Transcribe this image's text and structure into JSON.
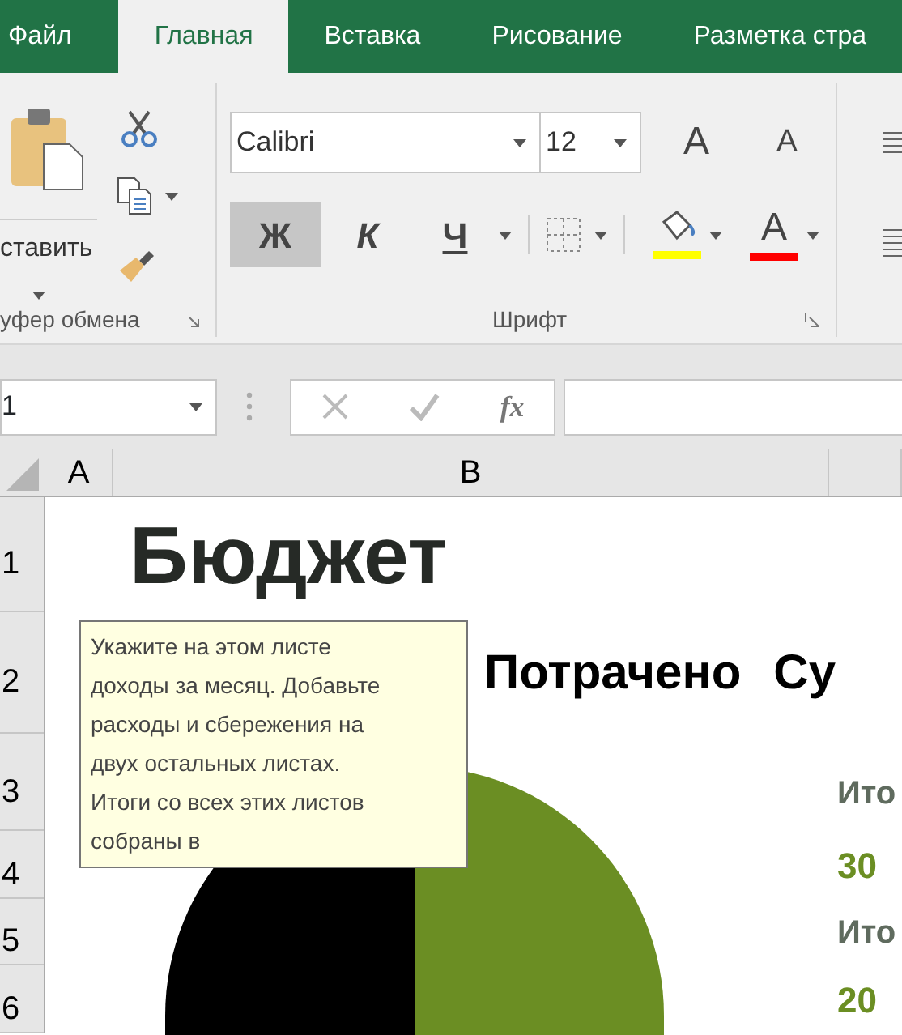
{
  "ribbon_tabs": [
    {
      "label": "Файл",
      "selected": false
    },
    {
      "label": "Главная",
      "selected": true
    },
    {
      "label": "Вставка",
      "selected": false
    },
    {
      "label": "Рисование",
      "selected": false
    },
    {
      "label": "Разметка стра",
      "selected": false
    }
  ],
  "clipboard_group": {
    "paste_label": "ставить",
    "label": "уфер обмена"
  },
  "font_group": {
    "font_name": "Calibri",
    "font_size": "12",
    "grow_font": "A",
    "shrink_font": "A",
    "format_buttons": [
      {
        "kind": "bold",
        "label": "Ж",
        "pressed": true
      },
      {
        "kind": "italic",
        "label": "К",
        "pressed": false
      },
      {
        "kind": "underline",
        "label": "Ч",
        "pressed": false
      }
    ],
    "font_color_label": "A",
    "label": "Шрифт"
  },
  "formula_bar": {
    "name_box": "1",
    "function_label": "fx"
  },
  "columns": [
    "A",
    "B"
  ],
  "rows": [
    "1",
    "2",
    "3",
    "4",
    "5",
    "6"
  ],
  "sheet": {
    "title": "Бюджет",
    "spent_heading": "Потрачено",
    "sum_heading": "Су",
    "totals": [
      {
        "label": "Ито",
        "value": "30"
      },
      {
        "label": "Ито",
        "value": "20"
      }
    ]
  },
  "tooltip": {
    "text": "Укажите на этом листе\nдоходы за месяц. Добавьте\nрасходы и сбережения на\nдвух остальных листах.\nИтоги со всех этих листов\nсобраны в"
  }
}
